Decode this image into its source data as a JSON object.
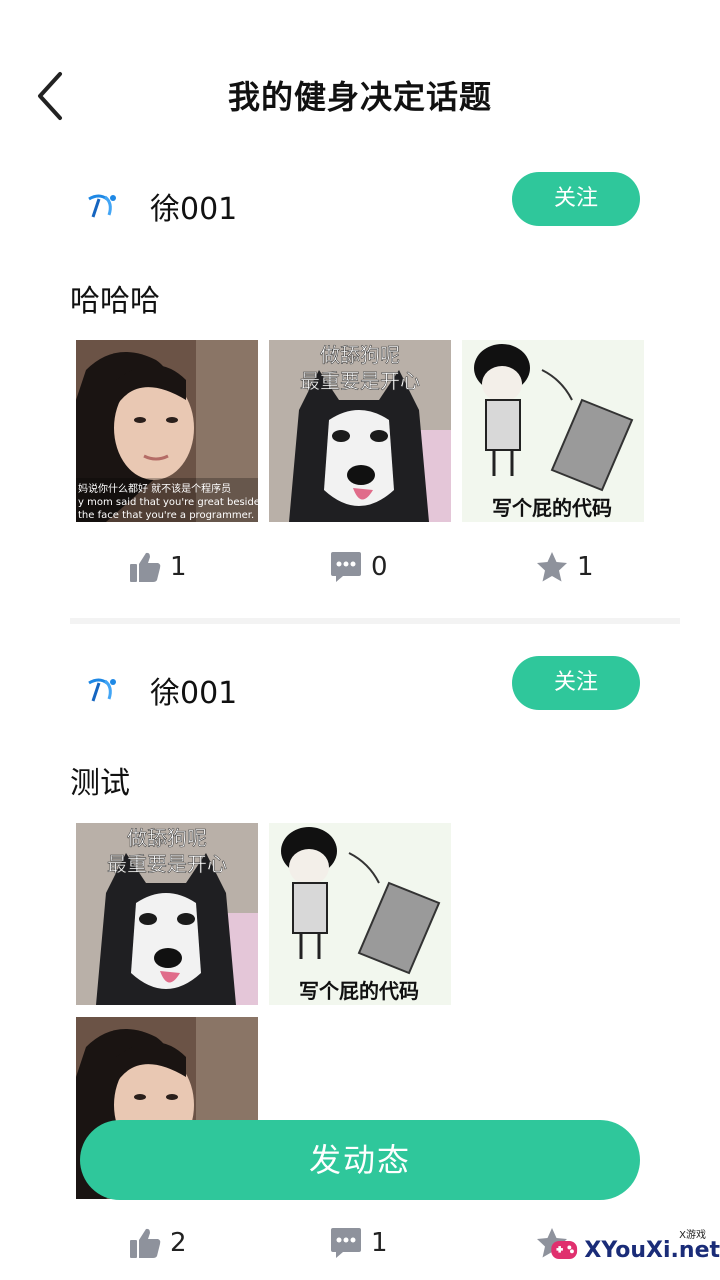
{
  "header": {
    "title": "我的健身决定话题"
  },
  "posts": [
    {
      "author": "徐001",
      "follow_label": "关注",
      "topic": "哈哈哈",
      "images": [
        {
          "caption1": "妈说你什么都好 就不该是个程序员",
          "caption2": "y mom said that you're great besides",
          "caption3": "the face that you're a programmer."
        },
        {
          "caption1": "做舔狗呢",
          "caption2": "最重要是开心"
        },
        {
          "caption1": "写个屁的代码"
        }
      ],
      "likes": "1",
      "comments": "0",
      "stars": "1"
    },
    {
      "author": "徐001",
      "follow_label": "关注",
      "topic": "测试",
      "images": [
        {
          "caption1": "做舔狗呢",
          "caption2": "最重要是开心"
        },
        {
          "caption1": "写个屁的代码"
        },
        {
          "caption1": ""
        }
      ],
      "likes": "2",
      "comments": "1",
      "stars": ""
    }
  ],
  "fab_label": "发动态",
  "watermark": {
    "brand": "XYouXi.net",
    "small": "X游戏"
  },
  "colors": {
    "accent": "#2fc79b",
    "icon_gray": "#8e929c"
  },
  "icons": [
    "back-icon",
    "thumb-up-icon",
    "comment-icon",
    "star-icon"
  ]
}
